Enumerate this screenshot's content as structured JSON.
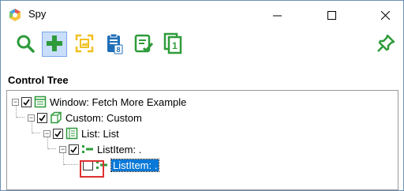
{
  "window": {
    "title": "Spy"
  },
  "panel": {
    "title": "Control Tree"
  },
  "toolbar": {
    "items": [
      "search-icon",
      "add-icon",
      "capture-icon",
      "clipboard-icon",
      "checklist-icon",
      "copy-icon",
      "pin-icon"
    ]
  },
  "tree": {
    "nodes": [
      {
        "label": "Window: Fetch More Example",
        "checked": true
      },
      {
        "label": "Custom: Custom",
        "checked": true
      },
      {
        "label": "List: List",
        "checked": true
      },
      {
        "label": "ListItem: .",
        "checked": true
      },
      {
        "label": "ListItem: .",
        "checked": false,
        "selected": true
      }
    ]
  },
  "colors": {
    "accent": "#0a78d7",
    "icon_green": "#2e9b3b",
    "highlight": "#e03030"
  }
}
